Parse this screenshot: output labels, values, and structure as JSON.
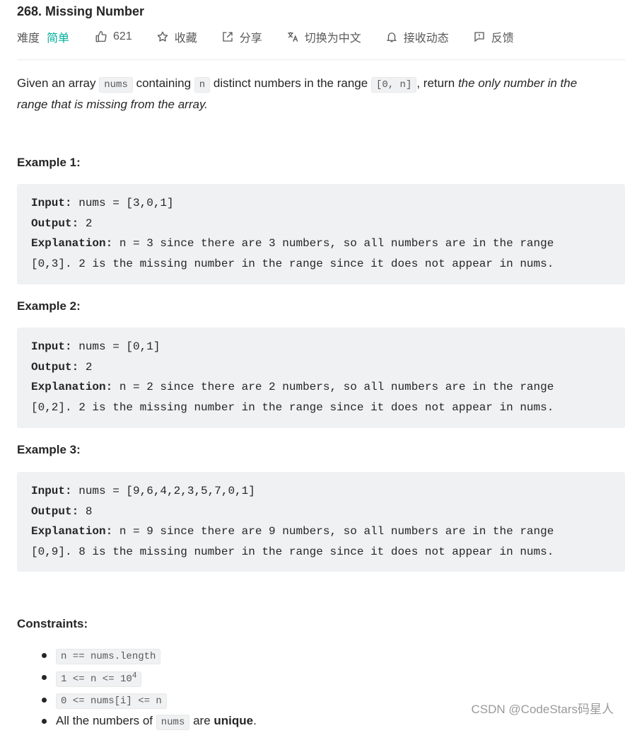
{
  "problem": {
    "title": "268. Missing Number",
    "difficulty_label": "难度",
    "difficulty": "简单",
    "likes": "621",
    "actions": {
      "favorite": "收藏",
      "share": "分享",
      "switch_lang": "切换为中文",
      "subscribe": "接收动态",
      "feedback": "反馈"
    }
  },
  "description": {
    "p1": "Given an array ",
    "c1": "nums",
    "p2": " containing ",
    "c2": "n",
    "p3": " distinct numbers in the range ",
    "c3": "[0, n]",
    "p4": ", return ",
    "em": "the only number in the range that is missing from the array."
  },
  "examples": [
    {
      "title": "Example 1:",
      "input_label": "Input:",
      "input": " nums = [3,0,1]",
      "output_label": "Output:",
      "output": " 2",
      "explanation_label": "Explanation:",
      "explanation": " n = 3 since there are 3 numbers, so all numbers are in the range\n[0,3]. 2 is the missing number in the range since it does not appear in nums."
    },
    {
      "title": "Example 2:",
      "input_label": "Input:",
      "input": " nums = [0,1]",
      "output_label": "Output:",
      "output": " 2",
      "explanation_label": "Explanation:",
      "explanation": " n = 2 since there are 2 numbers, so all numbers are in the range\n[0,2]. 2 is the missing number in the range since it does not appear in nums."
    },
    {
      "title": "Example 3:",
      "input_label": "Input:",
      "input": " nums = [9,6,4,2,3,5,7,0,1]",
      "output_label": "Output:",
      "output": " 8",
      "explanation_label": "Explanation:",
      "explanation": " n = 9 since there are 9 numbers, so all numbers are in the range\n[0,9]. 8 is the missing number in the range since it does not appear in nums."
    }
  ],
  "constraints": {
    "title": "Constraints:",
    "c1": "n == nums.length",
    "c2_base": "1 <= n <= 10",
    "c2_exp": "4",
    "c3": "0 <= nums[i] <= n",
    "c4_pre": "All the numbers of ",
    "c4_code": "nums",
    "c4_mid": " are ",
    "c4_bold": "unique",
    "c4_post": "."
  },
  "watermark": "CSDN @CodeStars码星人",
  "colors": {
    "easy": "#00af9b",
    "code_bg": "#f0f1f3",
    "text": "#262626"
  }
}
